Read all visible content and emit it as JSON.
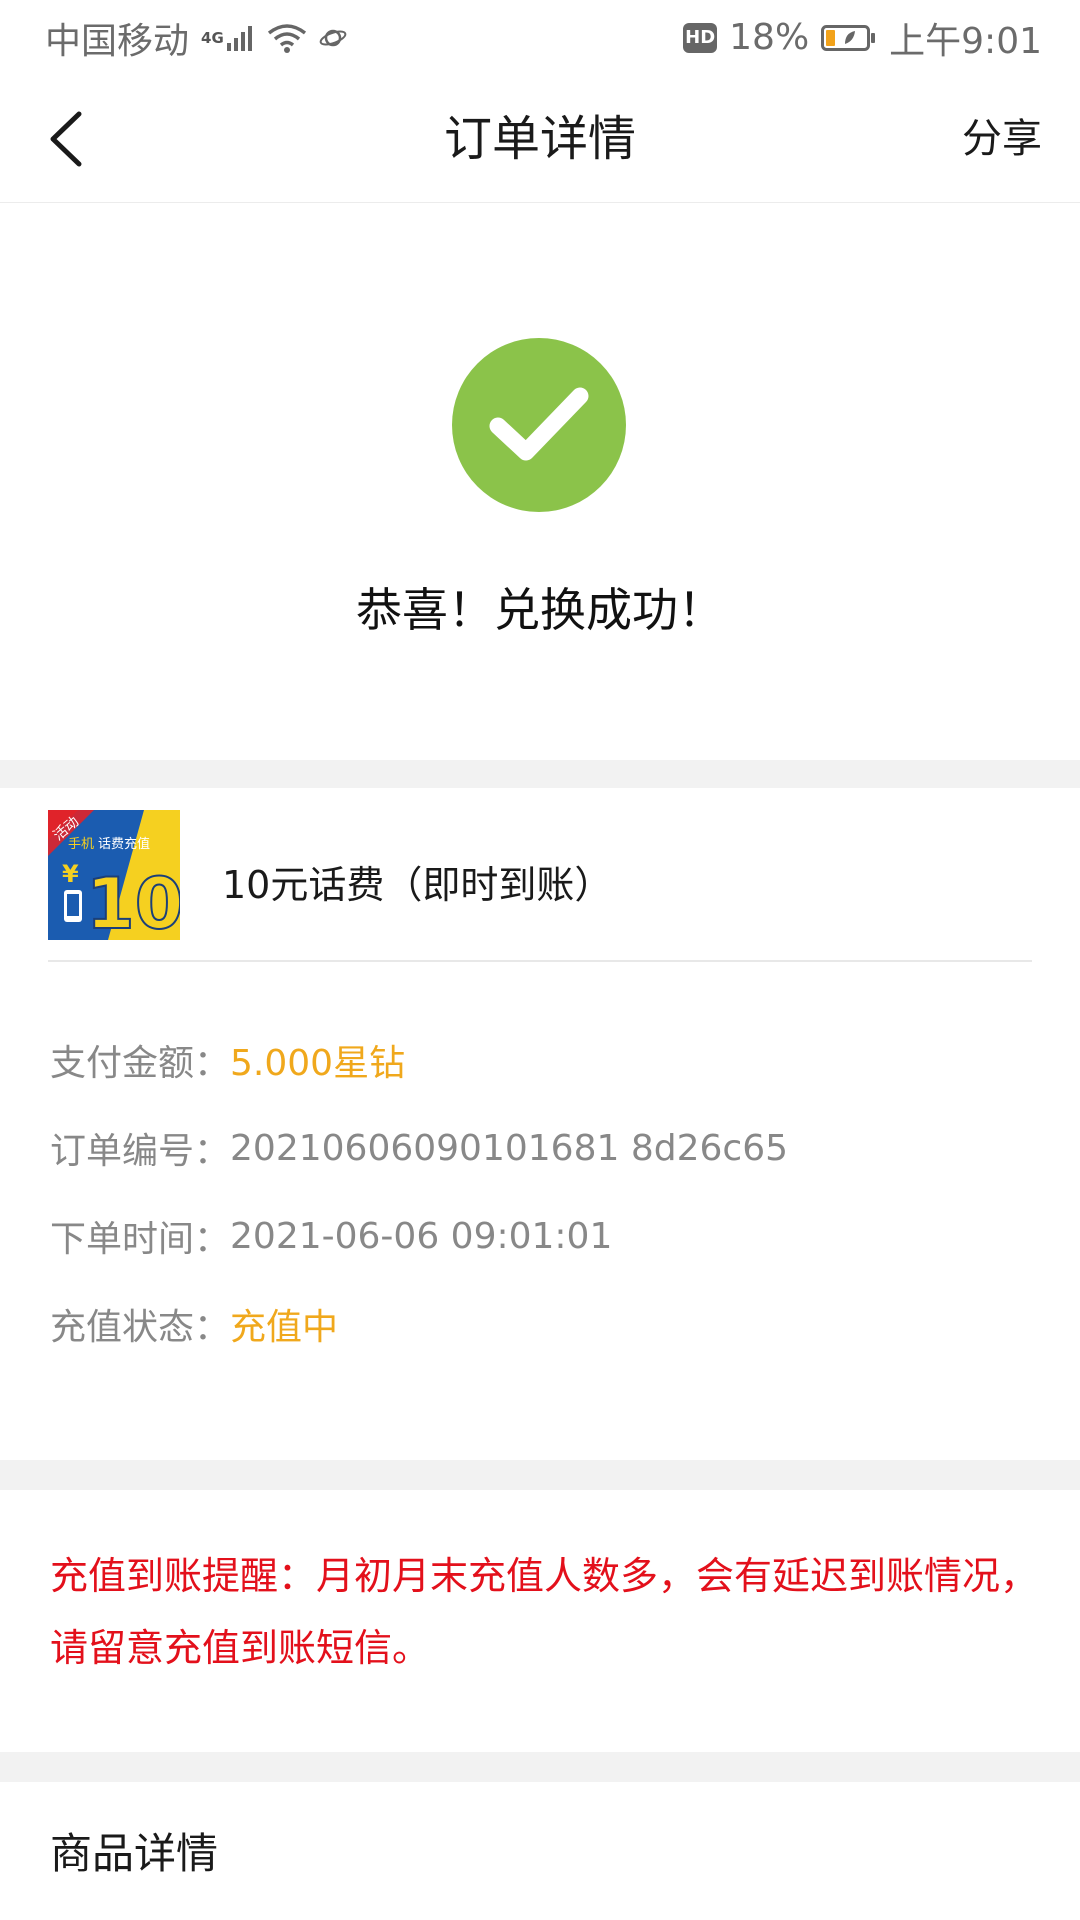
{
  "status_bar": {
    "carrier": "中国移动",
    "network": "4G",
    "hd": "HD",
    "battery": "18%",
    "time": "上午9:01"
  },
  "header": {
    "title": "订单详情",
    "share": "分享"
  },
  "success": {
    "message": "恭喜！兑换成功！"
  },
  "product": {
    "name": "10元话费（即时到账）",
    "thumb": {
      "badge": "活动",
      "caption_1": "手机",
      "caption_2": "话费充值",
      "currency": "¥",
      "amount": "10"
    }
  },
  "info": [
    {
      "label": "支付金额：",
      "value": "5.000星钻"
    },
    {
      "label": "订单编号：",
      "value": "20210606090101681 8d26c65"
    },
    {
      "label": "下单时间：",
      "value": "2021-06-06 09:01:01"
    },
    {
      "label": "充值状态：",
      "value": "充值中"
    }
  ],
  "reminder": "充值到账提醒：月初月末充值人数多，会有延迟到账情况，请留意充值到账短信。",
  "goods_detail": "商品详情",
  "colors": {
    "success_green": "#8bc34a",
    "accent_orange": "#f0a81c",
    "warning_red": "#e3101b"
  }
}
